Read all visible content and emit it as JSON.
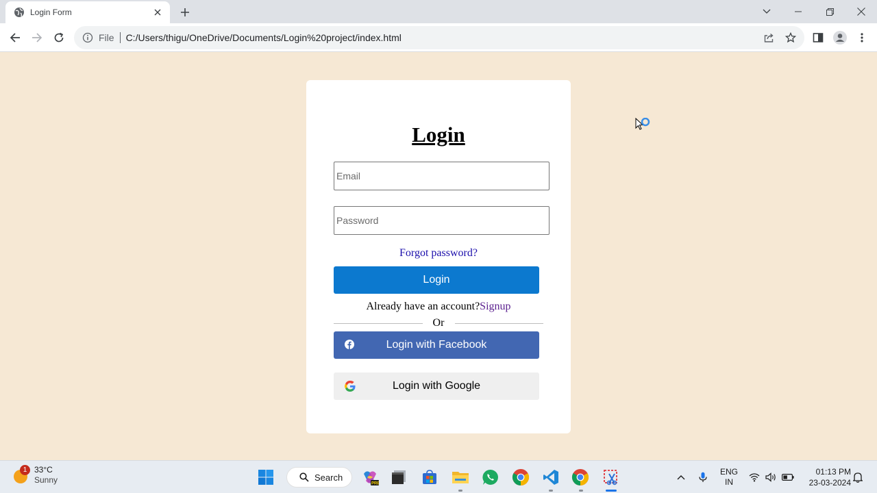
{
  "browser": {
    "tab_title": "Login Form",
    "omnibox_scheme_label": "File",
    "url": "C:/Users/thigu/OneDrive/Documents/Login%20project/index.html"
  },
  "page": {
    "title": "Login",
    "email_placeholder": "Email",
    "email_value": "",
    "password_placeholder": "Password",
    "password_value": "",
    "forgot_label": "Forgot password?",
    "login_button": "Login",
    "account_prompt": "Already have an account?",
    "signup_link": "Signup",
    "or_label": "Or",
    "facebook_button": "Login with Facebook",
    "google_button": "Login with Google"
  },
  "colors": {
    "page_background": "#f6e8d4",
    "login_button": "#0c79cf",
    "facebook_button": "#4267b2",
    "google_button": "#efefef"
  },
  "taskbar": {
    "weather_alert_count": "1",
    "temperature": "33°C",
    "condition": "Sunny",
    "search_label": "Search",
    "language_top": "ENG",
    "language_bottom": "IN",
    "time": "01:13 PM",
    "date": "23-03-2024",
    "apps": [
      "start-icon",
      "copilot-icon",
      "terminal-icon",
      "store-icon",
      "file-explorer-icon",
      "whatsapp-icon",
      "chrome-icon",
      "vscode-icon",
      "chrome-icon",
      "snipping-tool-icon"
    ]
  }
}
